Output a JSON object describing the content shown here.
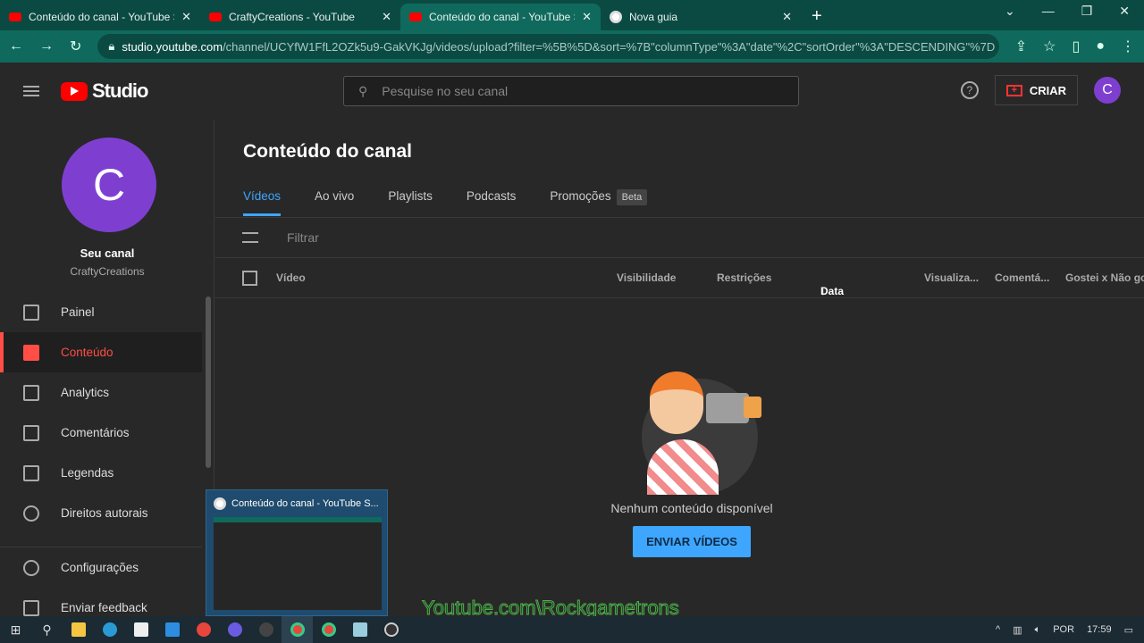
{
  "browser": {
    "tabs": [
      {
        "title": "Conteúdo do canal - YouTube Studio",
        "icon": "youtube-icon",
        "active": false
      },
      {
        "title": "CraftyCreations - YouTube",
        "icon": "youtube-icon",
        "active": false
      },
      {
        "title": "Conteúdo do canal - YouTube Studio",
        "icon": "youtube-icon",
        "active": true
      },
      {
        "title": "Nova guia",
        "icon": "chrome-icon",
        "active": false
      }
    ],
    "url_host": "studio.youtube.com",
    "url_path": "/channel/UCYfW1FfL2OZk5u9-GakVKJg/videos/upload?filter=%5B%5D&sort=%7B\"columnType\"%3A\"date\"%2C\"sortOrder\"%3A\"DESCENDING\"%7D"
  },
  "header": {
    "logo_text": "Studio",
    "search_placeholder": "Pesquise no seu canal",
    "create_label": "CRIAR",
    "avatar_letter": "C"
  },
  "sidebar": {
    "avatar_letter": "C",
    "channel_label": "Seu canal",
    "channel_name": "CraftyCreations",
    "items": [
      {
        "label": "Painel",
        "icon": "dashboard-icon"
      },
      {
        "label": "Conteúdo",
        "icon": "content-icon",
        "active": true
      },
      {
        "label": "Analytics",
        "icon": "analytics-icon"
      },
      {
        "label": "Comentários",
        "icon": "comments-icon"
      },
      {
        "label": "Legendas",
        "icon": "subtitles-icon"
      },
      {
        "label": "Direitos autorais",
        "icon": "copyright-icon"
      }
    ],
    "bottom": [
      {
        "label": "Configurações",
        "icon": "gear-icon"
      },
      {
        "label": "Enviar feedback",
        "icon": "feedback-icon"
      }
    ]
  },
  "main": {
    "title": "Conteúdo do canal",
    "tabs": [
      {
        "label": "Vídeos",
        "active": true
      },
      {
        "label": "Ao vivo"
      },
      {
        "label": "Playlists"
      },
      {
        "label": "Podcasts"
      },
      {
        "label": "Promoções",
        "badge": "Beta"
      }
    ],
    "filter_placeholder": "Filtrar",
    "columns": [
      "Vídeo",
      "Visibilidade",
      "Restrições",
      "Data",
      "Visualiza...",
      "Comentá...",
      "Gostei x Não go..."
    ],
    "empty_text": "Nenhum conteúdo disponível",
    "upload_button": "ENVIAR VÍDEOS"
  },
  "preview": {
    "title": "Conteúdo do canal - YouTube S..."
  },
  "watermark": "Youtube.com\\Rockgametrons",
  "taskbar": {
    "language": "POR",
    "time": "17:59"
  },
  "colors": {
    "accent": "#3ea6ff",
    "active_red": "#ff4e45",
    "avatar": "#7e3fd1",
    "browser": "#0f6a5d"
  }
}
